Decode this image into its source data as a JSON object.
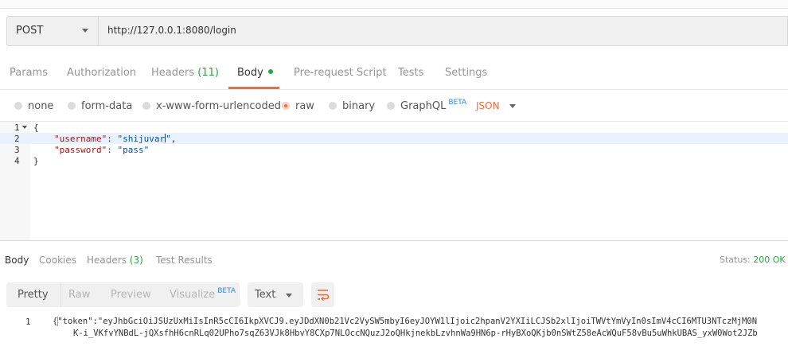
{
  "request": {
    "method": "POST",
    "url": "http://127.0.0.1:8080/login"
  },
  "request_tabs": [
    {
      "label": "Params"
    },
    {
      "label": "Authorization"
    },
    {
      "label": "Headers",
      "count": "(11)"
    },
    {
      "label": "Body"
    },
    {
      "label": "Pre-request Script"
    },
    {
      "label": "Tests"
    },
    {
      "label": "Settings"
    }
  ],
  "body_modes": {
    "none": "none",
    "form_data": "form-data",
    "urlencoded": "x-www-form-urlencoded",
    "raw": "raw",
    "binary": "binary",
    "graphql": "GraphQL",
    "beta": "BETA",
    "format": "JSON"
  },
  "editor": {
    "line_numbers": [
      "1",
      "2",
      "3",
      "4"
    ],
    "open_brace": "{",
    "key1": "\"username\"",
    "val1_a": "\"shijuvar",
    "val1_b": "\"",
    "key2": "\"password\"",
    "val2": "\"pass\"",
    "close_brace": "}",
    "colon": ": ",
    "comma": ","
  },
  "response_tabs": [
    {
      "label": "Body"
    },
    {
      "label": "Cookies"
    },
    {
      "label": "Headers",
      "count": "(3)"
    },
    {
      "label": "Test Results"
    }
  ],
  "status": {
    "label": "Status:",
    "value": "200 OK"
  },
  "view_modes": {
    "pretty": "Pretty",
    "raw": "Raw",
    "preview": "Preview",
    "visualize": "Visualize",
    "beta": "BETA",
    "format": "Text"
  },
  "response": {
    "line_number": "1",
    "line1_brace": "{",
    "line1_rest": "\"token\":\"eyJhbGciOiJSUzUxMiIsInR5cCI6IkpXVCJ9.eyJDdXN0b21Vc2VySW5mbyI6eyJOYW1lIjoic2hpanV2YXIiLCJSb2xlIjoiTWVtYmVyIn0sImV4cCI6MTU3NTczMjM0N",
    "line2": "K-i_VKfvYNBdL-jQXsfhH6cnRLq02UPho7sqZ63VJk8HbvY8CXp7NLOccNQuzJ2oQHkjnekbLzvhnWa9HN6p-rHyBXoQKjb0nSWtZ58eAcWQuF58vBu5uWhkUBAS_yxW0Wot2JZb"
  },
  "colors": {
    "accent": "#f26b3a",
    "success": "#28a745",
    "beta": "#2b8ad8"
  }
}
